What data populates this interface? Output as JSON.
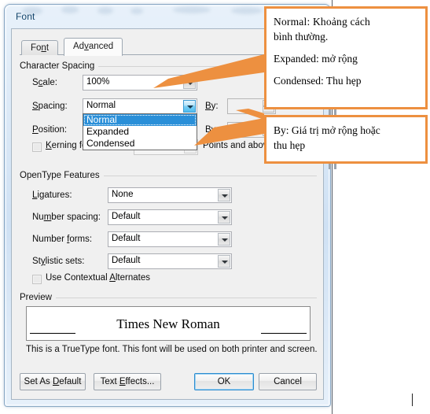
{
  "window": {
    "title": "Font"
  },
  "tabs": [
    {
      "label": "Font",
      "active": false
    },
    {
      "label": "Advanced",
      "active": true
    }
  ],
  "groups": {
    "character_spacing": "Character Spacing",
    "opentype_features": "OpenType Features",
    "preview": "Preview"
  },
  "character_spacing": {
    "scale_label": "Scale:",
    "scale_value": "100%",
    "spacing_label": "Spacing:",
    "spacing_value": "Normal",
    "spacing_by_label": "By:",
    "spacing_by_value": "",
    "position_label": "Position:",
    "position_value": "",
    "position_by_label": "By:",
    "position_by_value": "",
    "kerning_label": "Kerning for fonts:",
    "kerning_checked": false,
    "kerning_value": "",
    "points_suffix": "Points and above"
  },
  "spacing_dropdown": {
    "open": true,
    "options": [
      "Normal",
      "Expanded",
      "Condensed"
    ],
    "selected": "Normal"
  },
  "opentype": {
    "ligatures_label": "Ligatures:",
    "ligatures_value": "None",
    "number_spacing_label": "Number spacing:",
    "number_spacing_value": "Default",
    "number_forms_label": "Number forms:",
    "number_forms_value": "Default",
    "stylistic_sets_label": "Stylistic sets:",
    "stylistic_sets_value": "Default",
    "contextual_alternates_label": "Use Contextual Alternates",
    "contextual_alternates_checked": false
  },
  "preview": {
    "sample_text": "Times New Roman",
    "note": "This is a TrueType font. This font will be used on both printer and screen."
  },
  "buttons": {
    "set_as_default": "Set As Default",
    "text_effects": "Text Effects...",
    "ok": "OK",
    "cancel": "Cancel"
  },
  "annotations": {
    "box1_line1": "Normal:  Khoảng  cách",
    "box1_line2": "bình thường.",
    "box1_line3": "Expanded: mở rộng",
    "box1_line4": "Condensed: Thu hẹp",
    "box2_line1": "By: Giá trị mở rộng hoặc",
    "box2_line2": "thu hẹp"
  },
  "colors": {
    "callout_border": "#ED9040",
    "selection_blue": "#2A8FD8",
    "title_text": "#14456B"
  }
}
